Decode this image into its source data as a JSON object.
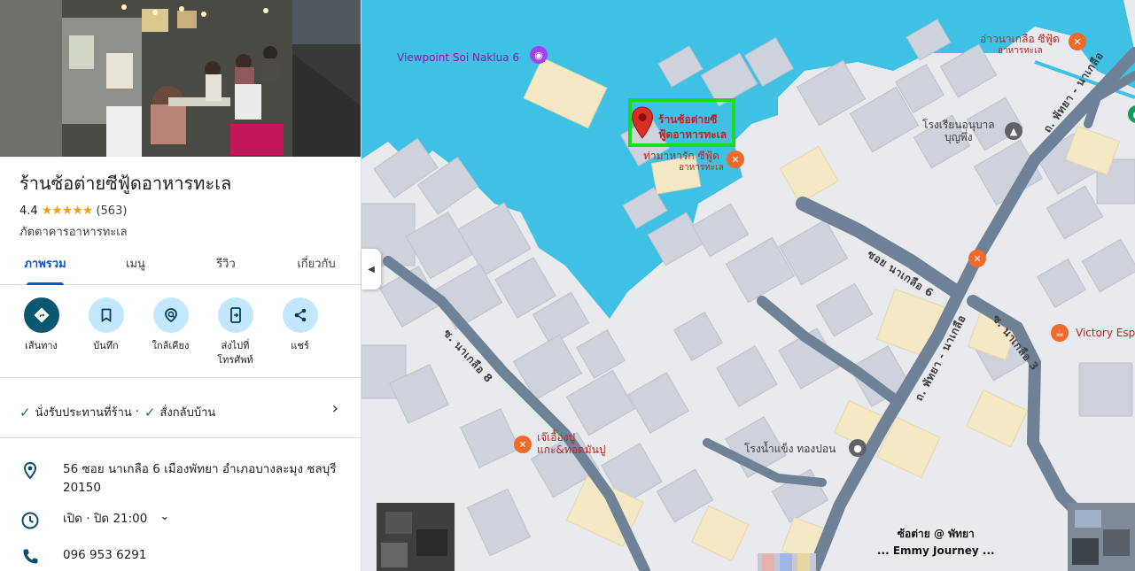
{
  "place": {
    "name": "ร้านซ้อต่ายซีฟู้ดอาหารทะเล",
    "rating": "4.4",
    "stars": "★★★★★",
    "review_count": "(563)",
    "category": "ภัตตาคารอาหารทะเล"
  },
  "tabs": [
    {
      "label": "ภาพรวม",
      "active": true
    },
    {
      "label": "เมนู"
    },
    {
      "label": "รีวิว"
    },
    {
      "label": "เกี่ยวกับ"
    }
  ],
  "actions": [
    {
      "label": "เส้นทาง",
      "icon": "directions-icon"
    },
    {
      "label": "บันทึก",
      "icon": "bookmark-icon"
    },
    {
      "label": "ใกล้เคียง",
      "icon": "nearby-icon"
    },
    {
      "label": "ส่งไปที่โทรศัพท์",
      "icon": "send-to-phone-icon"
    },
    {
      "label": "แชร์",
      "icon": "share-icon"
    }
  ],
  "service_options": {
    "dine_in": "นั่งรับประทานที่ร้าน",
    "separator": "·",
    "takeout": "สั่งกลับบ้าน"
  },
  "info": {
    "address": "56 ซอย นาเกลือ 6 เมืองพัทยา อำเภอบางละมุง ชลบุรี 20150",
    "hours": "เปิด · ปิด 21:00",
    "phone": "096 953 6291"
  },
  "map": {
    "selected_label_line1": "ร้านซ้อต่ายซี",
    "selected_label_line2": "ฟู้ดอาหารทะเล",
    "pois": {
      "viewpoint": "Viewpoint Soi Naklua 6",
      "ao_naklua_name": "อ่าวนาเกลือ ซีฟู้ด",
      "ao_naklua_sub": "อาหารทะเล",
      "tha_ma_harak_name": "ท่ามาหารัก ซีฟู้ด",
      "tha_ma_harak_sub": "อาหารทะเล",
      "school_line1": "โรงเรียนอนุบาล",
      "school_line2": "บุญพึ่ง",
      "victory": "Victory Esp",
      "je_euang_line1": "เจ๊เอื้องปู",
      "je_euang_line2": "แกะ&ทอดมันปู",
      "ice_factory": "โรงน้ำแข็ง ทองปอน"
    },
    "roads": {
      "soi_naklua_6": "ซอย นาเกลือ 6",
      "pattaya_naklua_upper": "ถ. พัทยา - นาเกลือ",
      "pattaya_naklua_lower": "ถ. พัทยา - นาเกลือ",
      "soi_naklua_3": "ซ. นาเกลือ 3",
      "soi_naklua_8": "ซ. นาเกลือ 8"
    },
    "watermark_line1": "ซ้อต่าย @ พัทยา",
    "watermark_line2": "... Emmy Journey ...",
    "colors": {
      "water": "#3fc1e6",
      "building": "#cdd2dc",
      "road": "#6f8197",
      "highlight": "#1bdc1b",
      "pin": "#d93025"
    }
  }
}
